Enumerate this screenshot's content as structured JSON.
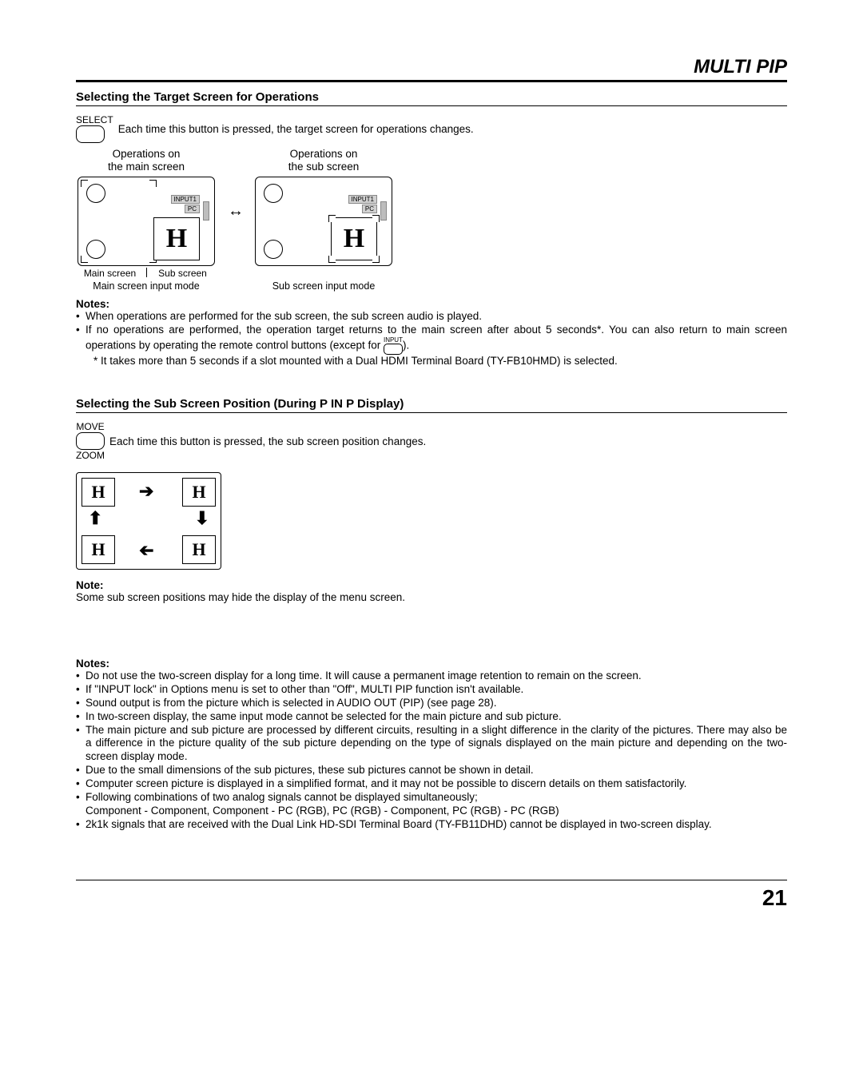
{
  "header": {
    "title": "MULTI PIP"
  },
  "section1": {
    "title": "Selecting the Target Screen for Operations",
    "select_label": "SELECT",
    "select_text": "Each time this button is pressed, the target screen for operations changes.",
    "diag": {
      "left_top": "Operations on\nthe main screen",
      "right_top": "Operations on\nthe sub screen",
      "input_label": "INPUT1",
      "pc_label": "PC",
      "H": "H",
      "main_screen": "Main screen",
      "sub_screen": "Sub screen",
      "left_bottom": "Main screen input mode",
      "right_bottom": "Sub screen input mode"
    },
    "notes_heading": "Notes:",
    "notes": [
      "When operations are performed for the sub screen, the sub screen audio is played.",
      "If no operations are performed, the operation target returns to the main screen after about 5 seconds*. You can also return to main screen operations by operating the remote control buttons (except for "
    ],
    "input_icon_label": "INPUT",
    "note2_tail": ").",
    "star_note": "* It takes more than 5 seconds if a slot mounted with a Dual HDMI Terminal Board (TY-FB10HMD) is selected."
  },
  "section2": {
    "title": "Selecting the Sub Screen Position (During P IN P Display)",
    "move_label": "MOVE",
    "zoom_label": "ZOOM",
    "move_text": "Each time this button is pressed, the sub screen position changes.",
    "H": "H",
    "note_heading": "Note:",
    "note_text": "Some sub screen positions may hide the display of the menu screen."
  },
  "section3": {
    "notes_heading": "Notes:",
    "items": [
      "Do not use the two-screen display for a long time. It will cause a permanent image retention to remain on the screen.",
      "If \"INPUT lock\" in Options menu is set to other than \"Off\", MULTI PIP function isn't available.",
      "Sound output is from the picture which is selected in AUDIO OUT (PIP) (see page 28).",
      "In two-screen display, the same input mode cannot be selected for the main picture and sub picture.",
      "The main picture and sub picture are processed by different circuits, resulting in a slight difference in the clarity of the pictures. There may also be a difference in the picture quality of the sub picture depending on the type of signals displayed on the main picture and depending on the two-screen display mode.",
      "Due to the small dimensions of the sub pictures, these sub pictures cannot be shown in detail.",
      "Computer screen picture is displayed in a simplified format, and it may not be possible to discern details on them satisfactorily.",
      "Following combinations of two analog signals cannot be displayed simultaneously;\nComponent - Component, Component - PC (RGB), PC (RGB) - Component, PC (RGB) - PC (RGB)",
      "2k1k signals that are received with the Dual Link HD-SDI Terminal Board (TY-FB11DHD) cannot be displayed in two-screen display."
    ]
  },
  "page_number": "21"
}
